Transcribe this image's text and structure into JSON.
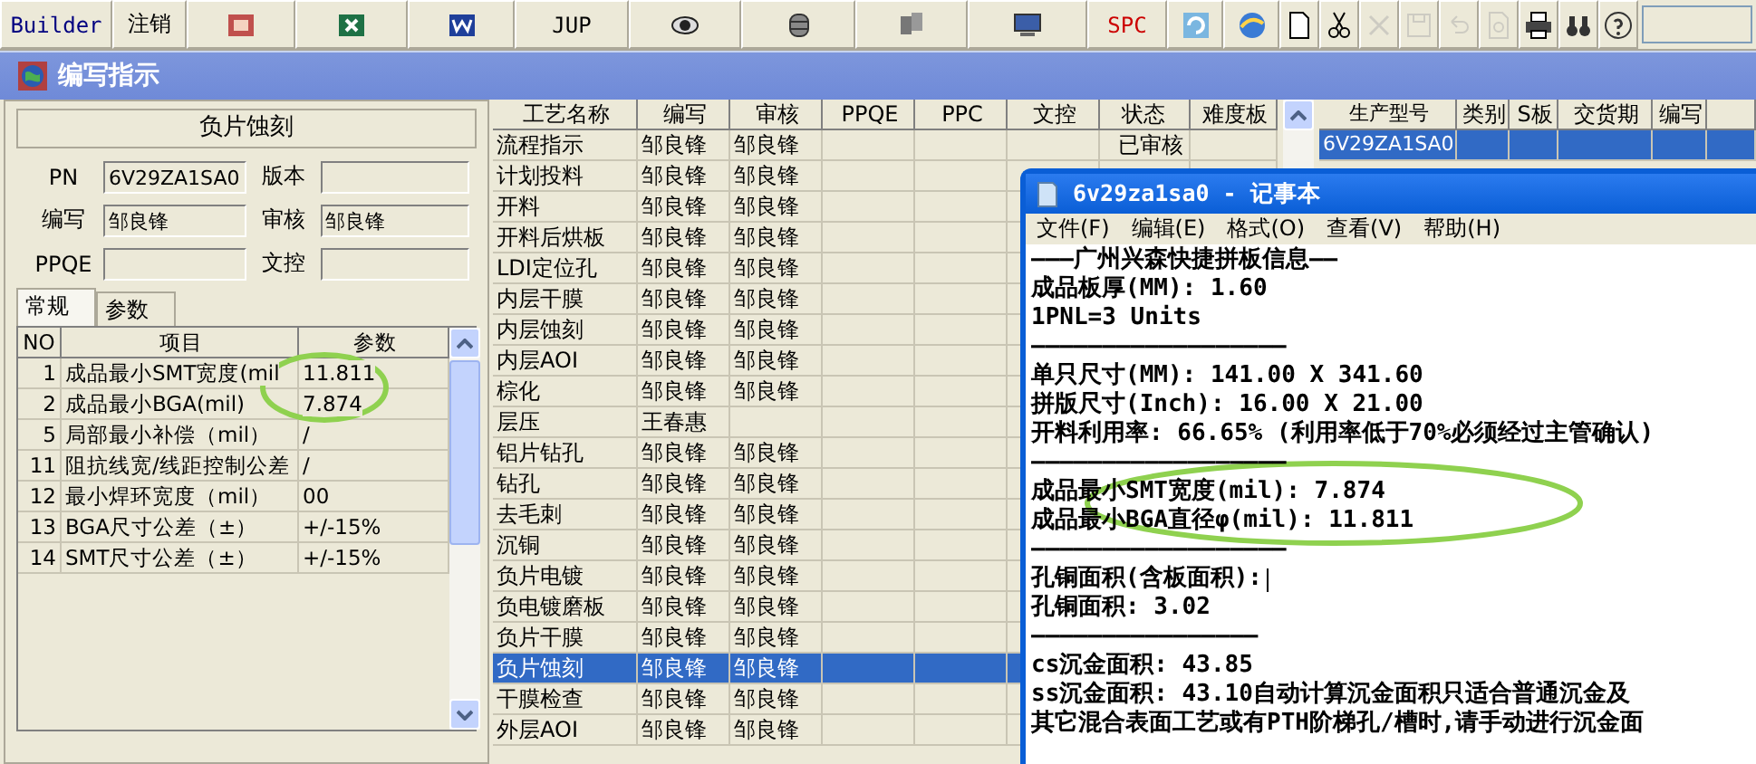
{
  "toolbar": [
    {
      "kind": "text",
      "label": "Builder",
      "color": "#000080"
    },
    {
      "kind": "text",
      "label": "注销",
      "color": "#000000"
    },
    {
      "kind": "icon",
      "disabled": false
    },
    {
      "kind": "icon",
      "disabled": false
    },
    {
      "kind": "icon",
      "disabled": false
    },
    {
      "kind": "text",
      "label": "JUP",
      "color": "#000000"
    },
    {
      "kind": "icon",
      "disabled": false
    },
    {
      "kind": "icon",
      "disabled": false
    },
    {
      "kind": "icon",
      "disabled": false
    },
    {
      "kind": "icon",
      "disabled": false
    },
    {
      "kind": "text",
      "label": "SPC",
      "color": "#cc0000"
    },
    {
      "kind": "icon",
      "disabled": false
    },
    {
      "kind": "icon",
      "disabled": false
    },
    {
      "kind": "icon",
      "disabled": false
    },
    {
      "kind": "icon",
      "disabled": false
    },
    {
      "kind": "icon",
      "disabled": true
    },
    {
      "kind": "icon",
      "disabled": true
    },
    {
      "kind": "icon",
      "disabled": true
    },
    {
      "kind": "icon",
      "disabled": true
    },
    {
      "kind": "icon",
      "disabled": false
    },
    {
      "kind": "icon",
      "disabled": false
    },
    {
      "kind": "icon",
      "disabled": false
    }
  ],
  "window": {
    "title": "编写指示"
  },
  "step_panel": {
    "title": "负片蚀刻",
    "fields": [
      {
        "label": "PN",
        "value": "6V29ZA1SA0"
      },
      {
        "label": "版本"
      },
      {
        "label": "编写",
        "value": "邹良锋"
      },
      {
        "label": "审核",
        "value": "邹良锋"
      },
      {
        "label": "PPQE"
      },
      {
        "label": "文控"
      }
    ],
    "tabs": [
      {
        "label": "常规",
        "selected": true
      },
      {
        "label": "参数",
        "selected": false
      }
    ],
    "params": {
      "columns": [
        "NO",
        "项目",
        "参数"
      ],
      "rows": [
        [
          "1",
          "成品最小SMT宽度(mil",
          "11.811"
        ],
        [
          "2",
          "成品最小BGA(mil)",
          "7.874"
        ],
        [
          "5",
          "局部最小补偿（mil）",
          "/"
        ],
        [
          "11",
          "阻抗线宽/线距控制公差",
          "/"
        ],
        [
          "12",
          "最小焊环宽度（mil）",
          "00"
        ],
        [
          "13",
          "BGA尺寸公差（±）",
          "+/-15%"
        ],
        [
          "14",
          "SMT尺寸公差（±）",
          "+/-15%"
        ]
      ]
    }
  },
  "process_table": {
    "columns": [
      "工艺名称",
      "编写",
      "审核",
      "PPQE",
      "PPC",
      "文控",
      "状态",
      "难度板"
    ],
    "rows": [
      {
        "name": "流程指示",
        "writer": "邹良锋",
        "reviewer": "邹良锋",
        "status": "已审核",
        "selected": false
      },
      {
        "name": "计划投料",
        "writer": "邹良锋",
        "reviewer": "邹良锋",
        "selected": false
      },
      {
        "name": "开料",
        "writer": "邹良锋",
        "reviewer": "邹良锋",
        "selected": false
      },
      {
        "name": "开料后烘板",
        "writer": "邹良锋",
        "reviewer": "邹良锋",
        "selected": false
      },
      {
        "name": "LDI定位孔",
        "writer": "邹良锋",
        "reviewer": "邹良锋",
        "selected": false
      },
      {
        "name": "内层干膜",
        "writer": "邹良锋",
        "reviewer": "邹良锋",
        "selected": false
      },
      {
        "name": "内层蚀刻",
        "writer": "邹良锋",
        "reviewer": "邹良锋",
        "selected": false
      },
      {
        "name": "内层AOI",
        "writer": "邹良锋",
        "reviewer": "邹良锋",
        "selected": false
      },
      {
        "name": "棕化",
        "writer": "邹良锋",
        "reviewer": "邹良锋",
        "selected": false
      },
      {
        "name": "层压",
        "writer": "王春惠",
        "selected": false
      },
      {
        "name": "铝片钻孔",
        "writer": "邹良锋",
        "reviewer": "邹良锋",
        "selected": false
      },
      {
        "name": "钻孔",
        "writer": "邹良锋",
        "reviewer": "邹良锋",
        "selected": false
      },
      {
        "name": "去毛刺",
        "writer": "邹良锋",
        "reviewer": "邹良锋",
        "selected": false
      },
      {
        "name": "沉铜",
        "writer": "邹良锋",
        "reviewer": "邹良锋",
        "selected": false
      },
      {
        "name": "负片电镀",
        "writer": "邹良锋",
        "reviewer": "邹良锋",
        "selected": false
      },
      {
        "name": "负电镀磨板",
        "writer": "邹良锋",
        "reviewer": "邹良锋",
        "selected": false
      },
      {
        "name": "负片干膜",
        "writer": "邹良锋",
        "reviewer": "邹良锋",
        "selected": false
      },
      {
        "name": "负片蚀刻",
        "writer": "邹良锋",
        "reviewer": "邹良锋",
        "selected": true
      },
      {
        "name": "干膜检查",
        "writer": "邹良锋",
        "reviewer": "邹良锋",
        "selected": false
      },
      {
        "name": "外层AOI",
        "writer": "邹良锋",
        "reviewer": "邹良锋",
        "selected": false
      }
    ]
  },
  "order_table": {
    "columns": [
      "生产型号",
      "类别",
      "S板",
      "交货期",
      "编写"
    ],
    "rows": [
      {
        "model": "6V29ZA1SA0",
        "selected": true
      }
    ]
  },
  "notepad": {
    "title": "6v29za1sa0 - 记事本",
    "menu": [
      "文件(F)",
      "编辑(E)",
      "格式(O)",
      "查看(V)",
      "帮助(H)"
    ],
    "lines": [
      {
        "text": "———广州兴森快捷拼板信息——"
      },
      {
        "text": "成品板厚(MM): 1.60"
      },
      {
        "text": "1PNL=3 Units"
      },
      {
        "text": "——————————————————"
      },
      {
        "text": "单只尺寸(MM): 141.00 X 341.60"
      },
      {
        "text": "拼版尺寸(Inch): 16.00 X 21.00"
      },
      {
        "text": "开料利用率: 66.65% (利用率低于70%必须经过主管确认)"
      },
      {
        "text": "——————————————————"
      },
      {
        "text": "成品最小SMT宽度(mil): 7.874"
      },
      {
        "text": "成品最小BGA直径φ(mil):  11.811"
      },
      {
        "text": "——————————————————"
      },
      {
        "text": "孔铜面积(含板面积):",
        "caret": true
      },
      {
        "text": "孔铜面积: 3.02"
      },
      {
        "text": "————————————————"
      },
      {
        "text": "cs沉金面积: 43.85"
      },
      {
        "text": "ss沉金面积: 43.10自动计算沉金面积只适合普通沉金及"
      },
      {
        "text": "其它混合表面工艺或有PTH阶梯孔/槽时,请手动进行沉金面"
      }
    ]
  }
}
